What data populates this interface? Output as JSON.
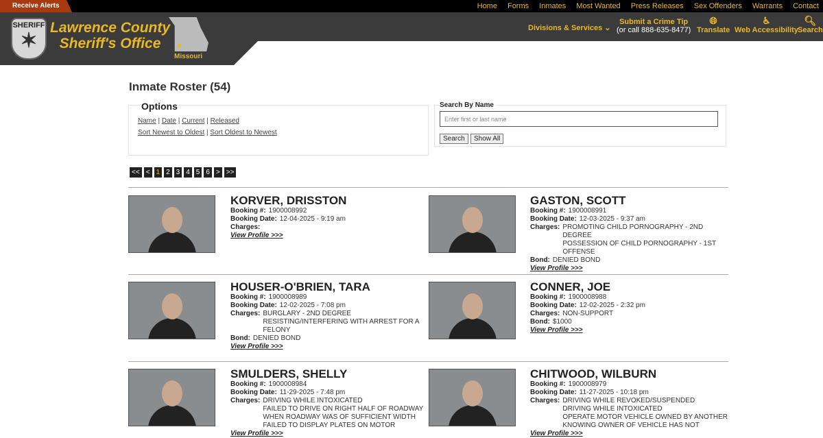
{
  "topbar": {
    "alerts": "Receive Alerts",
    "nav": [
      "Home",
      "Forms",
      "Inmates",
      "Most Wanted",
      "Press Releases",
      "Sex Offenders",
      "Warrants",
      "Contact"
    ]
  },
  "header": {
    "badge_text": "SHERIFF",
    "title_line1": "Lawrence County",
    "title_line2": "Sheriff's Office",
    "state": "Missouri",
    "divisions": "Divisions & Services",
    "tip_line1": "Submit a Crime Tip",
    "tip_line2": "(or call 888-635-8477)",
    "translate": "Translate",
    "accessibility": "Web Accessibility",
    "search": "Search",
    "accent": "#e9b825"
  },
  "page": {
    "title": "Inmate Roster (54)"
  },
  "options": {
    "heading": "Options",
    "filters": [
      "Name",
      "Date",
      "Current",
      "Released"
    ],
    "sorts": [
      "Sort Newest to Oldest",
      "Sort Oldest to Newest"
    ]
  },
  "search": {
    "label": "Search By Name",
    "placeholder": "Enter first or last name",
    "search_btn": "Search",
    "show_all_btn": "Show All"
  },
  "pager": [
    "<<",
    "<",
    "1",
    "2",
    "3",
    "4",
    "5",
    "6",
    ">",
    ">>"
  ],
  "labels": {
    "booking": "Booking #:",
    "date": "Booking Date:",
    "charges": "Charges:",
    "bond": "Bond:",
    "view": "View Profile >>>"
  },
  "inmates": [
    {
      "name": "KORVER, DRISSTON",
      "booking": "1900008992",
      "date": "12-04-2025 - 9:19 am",
      "charges": [],
      "bond": null
    },
    {
      "name": "GASTON, SCOTT",
      "booking": "1900008991",
      "date": "12-03-2025 - 9:37 am",
      "charges": [
        "PROMOTING CHILD PORNOGRAPHY - 2ND DEGREE",
        "POSSESSION OF CHILD PORNOGRAPHY - 1ST OFFENSE"
      ],
      "bond": "DENIED BOND"
    },
    {
      "name": "HOUSER-O'BRIEN, TARA",
      "booking": "1900008989",
      "date": "12-02-2025 - 7:08 pm",
      "charges": [
        "BURGLARY - 2ND DEGREE",
        "RESISTING/INTERFERING WITH ARREST FOR A FELONY"
      ],
      "bond": "DENIED BOND"
    },
    {
      "name": "CONNER, JOE",
      "booking": "1900008988",
      "date": "12-02-2025 - 2:32 pm",
      "charges": [
        "NON-SUPPORT"
      ],
      "bond": "$1000"
    },
    {
      "name": "SMULDERS, SHELLY",
      "booking": "1900008984",
      "date": "11-29-2025 - 7:48 pm",
      "charges": [
        "DRIVING WHILE INTOXICATED",
        "FAILED TO DRIVE ON RIGHT HALF OF ROADWAY WHEN ROADWAY WAS OF SUFFICIENT WIDTH",
        "FAILED TO DISPLAY PLATES ON MOTOR"
      ],
      "bond": null
    },
    {
      "name": "CHITWOOD, WILBURN",
      "booking": "1900008979",
      "date": "11-27-2025 - 10:18 pm",
      "charges": [
        "DRIVING WHILE REVOKED/SUSPENDED",
        "DRIVING WHILE INTOXICATED",
        "OPERATE MOTOR VEHICLE OWNED BY ANOTHER KNOWING OWNER OF VEHICLE HAS NOT"
      ],
      "bond": null
    }
  ]
}
